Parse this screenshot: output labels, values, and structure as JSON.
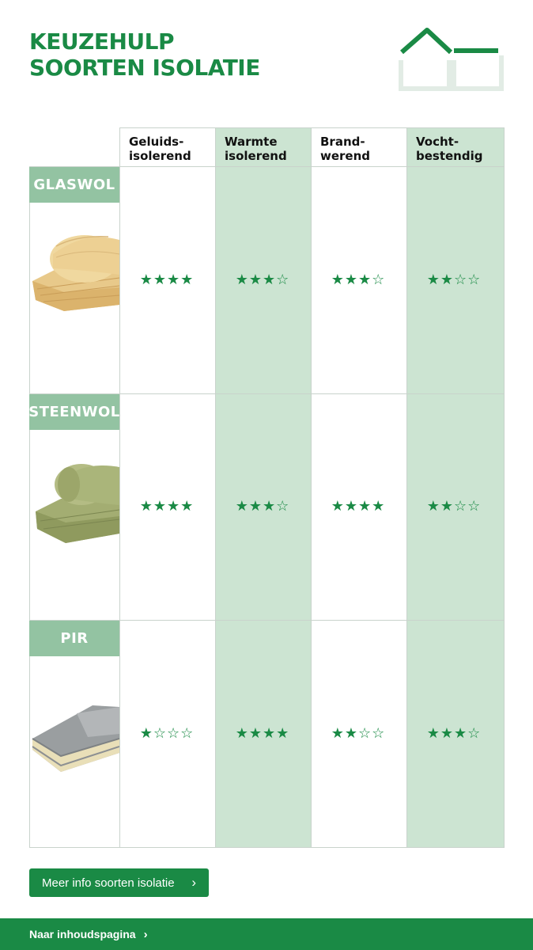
{
  "header": {
    "title_line1": "KEUZEHULP",
    "title_line2": "SOORTEN ISOLATIE",
    "logo_icon": "house-outline-icon"
  },
  "columns": [
    {
      "line1": "Geluids-",
      "line2": "isolerend"
    },
    {
      "line1": "Warmte",
      "line2": "isolerend"
    },
    {
      "line1": "Brand-",
      "line2": "werend"
    },
    {
      "line1": "Vocht-",
      "line2": "bestendig"
    }
  ],
  "rows": [
    {
      "label": "GLASWOL",
      "image": "glaswol-roll-image",
      "ratings": [
        4,
        3,
        3,
        2
      ],
      "stars_display": [
        "★★★★",
        "★★★☆",
        "★★★☆",
        "★★☆☆"
      ]
    },
    {
      "label": "STEENWOL",
      "image": "steenwol-roll-image",
      "ratings": [
        4,
        3,
        4,
        2
      ],
      "stars_display": [
        "★★★★",
        "★★★☆",
        "★★★★",
        "★★☆☆"
      ]
    },
    {
      "label": "PIR",
      "image": "pir-board-image",
      "ratings": [
        1,
        4,
        2,
        3
      ],
      "stars_display": [
        "★☆☆☆",
        "★★★★",
        "★★☆☆",
        "★★★☆"
      ]
    }
  ],
  "rating_max": 4,
  "button": {
    "label": "Meer info soorten isolatie",
    "icon": "chevron-right-icon"
  },
  "footer": {
    "label": "Naar inhoudspagina",
    "icon": "chevron-right-icon"
  },
  "colors": {
    "brand_green": "#1a8a45",
    "light_green": "#cce4d2",
    "label_green": "#93c3a2"
  }
}
